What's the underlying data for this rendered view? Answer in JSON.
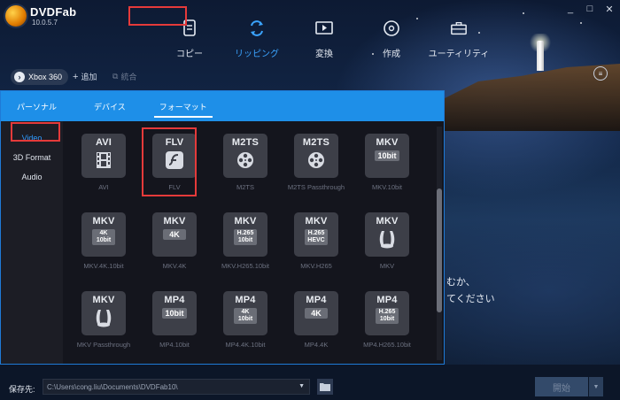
{
  "app": {
    "name": "DVDFab",
    "version": "10.0.5.7"
  },
  "window_controls": [
    "_",
    "□",
    "✕"
  ],
  "nav": [
    {
      "label": "コピー",
      "icon": "copy-icon",
      "active": false
    },
    {
      "label": "リッピング",
      "icon": "ripping-icon",
      "active": true
    },
    {
      "label": "変換",
      "icon": "convert-icon",
      "active": false
    },
    {
      "label": "作成",
      "icon": "create-disc-icon",
      "active": false
    },
    {
      "label": "ユーティリティ",
      "icon": "toolbox-icon",
      "active": false
    }
  ],
  "device_chip": {
    "label": "Xbox 360"
  },
  "add_button": {
    "label": "追加"
  },
  "merge_button": {
    "label": "統合"
  },
  "tabs": [
    {
      "label": "パーソナル",
      "active": false
    },
    {
      "label": "デバイス",
      "active": false
    },
    {
      "label": "フォーマット",
      "active": true
    }
  ],
  "sidebar": [
    {
      "label": "Video",
      "active": true
    },
    {
      "label": "3D Format",
      "active": false
    },
    {
      "label": "Audio",
      "active": false
    }
  ],
  "formats": [
    {
      "code": "AVI",
      "sub": "",
      "glyph": "film",
      "label": "AVI"
    },
    {
      "code": "FLV",
      "sub": "",
      "glyph": "flash",
      "label": "FLV"
    },
    {
      "code": "M2TS",
      "sub": "",
      "glyph": "reel",
      "label": "M2TS"
    },
    {
      "code": "M2TS",
      "sub": "",
      "glyph": "reel",
      "label": "M2TS Passthrough"
    },
    {
      "code": "MKV",
      "sub": "10bit",
      "glyph": "",
      "label": "MKV.10bit"
    },
    {
      "code": "MKV",
      "sub": "4K\n10bit",
      "glyph": "",
      "label": "MKV.4K.10bit"
    },
    {
      "code": "MKV",
      "sub": "4K",
      "glyph": "",
      "label": "MKV.4K"
    },
    {
      "code": "MKV",
      "sub": "H.265\n10bit",
      "glyph": "",
      "label": "MKV.H265.10bit"
    },
    {
      "code": "MKV",
      "sub": "H.265\nHEVC",
      "glyph": "",
      "label": "MKV.H265"
    },
    {
      "code": "MKV",
      "sub": "",
      "glyph": "matroska",
      "label": "MKV"
    },
    {
      "code": "MKV",
      "sub": "",
      "glyph": "matroska",
      "label": "MKV Passthrough"
    },
    {
      "code": "MP4",
      "sub": "10bit",
      "glyph": "",
      "label": "MP4.10bit"
    },
    {
      "code": "MP4",
      "sub": "4K\n10bit",
      "glyph": "",
      "label": "MP4.4K.10bit"
    },
    {
      "code": "MP4",
      "sub": "4K",
      "glyph": "",
      "label": "MP4.4K"
    },
    {
      "code": "MP4",
      "sub": "H.265\n10bit",
      "glyph": "",
      "label": "MP4.H265.10bit"
    }
  ],
  "overlay_text": {
    "line1": "むか、",
    "line2": "てください"
  },
  "save": {
    "label": "保存先:",
    "path": "C:\\Users\\cong.liu\\Documents\\DVDFab10\\"
  },
  "start_button": {
    "label": "開始"
  }
}
